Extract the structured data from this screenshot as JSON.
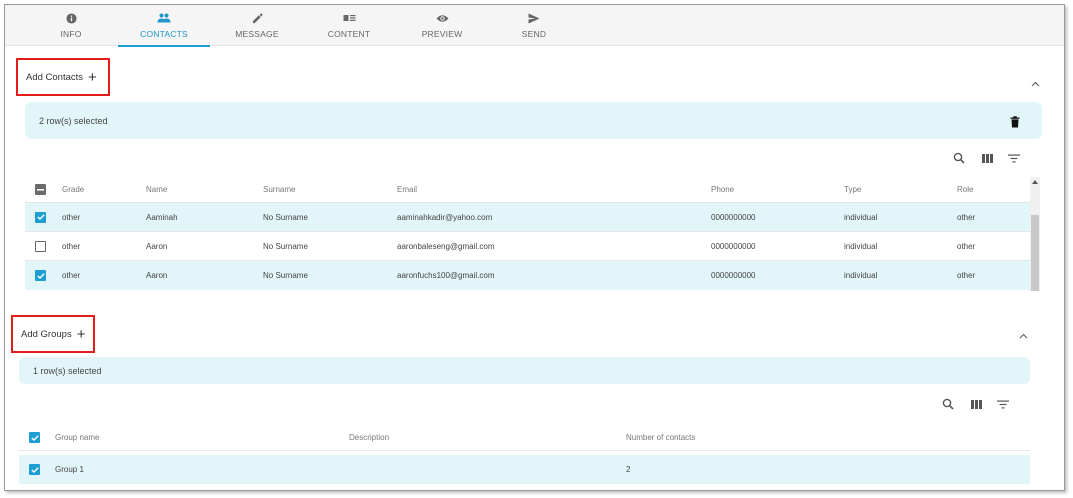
{
  "tabs": [
    {
      "label": "INFO",
      "icon": "info-icon",
      "active": false
    },
    {
      "label": "CONTACTS",
      "icon": "people-icon",
      "active": true
    },
    {
      "label": "MESSAGE",
      "icon": "pencil-icon",
      "active": false
    },
    {
      "label": "CONTENT",
      "icon": "content-icon",
      "active": false
    },
    {
      "label": "PREVIEW",
      "icon": "eye-icon",
      "active": false
    },
    {
      "label": "SEND",
      "icon": "send-icon",
      "active": false
    }
  ],
  "contacts": {
    "header": "Add Contacts",
    "plus": "+",
    "selected_text": "2 row(s) selected",
    "columns": [
      "Grade",
      "Name",
      "Surname",
      "Email",
      "Phone",
      "Type",
      "Role"
    ],
    "rows": [
      {
        "checked": true,
        "cells": [
          "other",
          "Aaminah",
          "No Surname",
          "aaminahkadir@yahoo.com",
          "0000000000",
          "individual",
          "other"
        ]
      },
      {
        "checked": false,
        "cells": [
          "other",
          "Aaron",
          "No Surname",
          "aaronbaleseng@gmail.com",
          "0000000000",
          "individual",
          "other"
        ]
      },
      {
        "checked": true,
        "cells": [
          "other",
          "Aaron",
          "No Surname",
          "aaronfuchs100@gmail.com",
          "0000000000",
          "individual",
          "other"
        ]
      }
    ]
  },
  "groups": {
    "header": "Add Groups",
    "plus": "+",
    "selected_text": "1 row(s) selected",
    "columns": [
      "Group name",
      "Description",
      "Number of contacts"
    ],
    "rows": [
      {
        "checked": true,
        "cells": [
          "Group 1",
          "",
          "2"
        ]
      }
    ]
  },
  "colors": {
    "accent": "#1e9fd4",
    "highlight": "#e2f6f9",
    "annotation": "#e21b1b"
  }
}
